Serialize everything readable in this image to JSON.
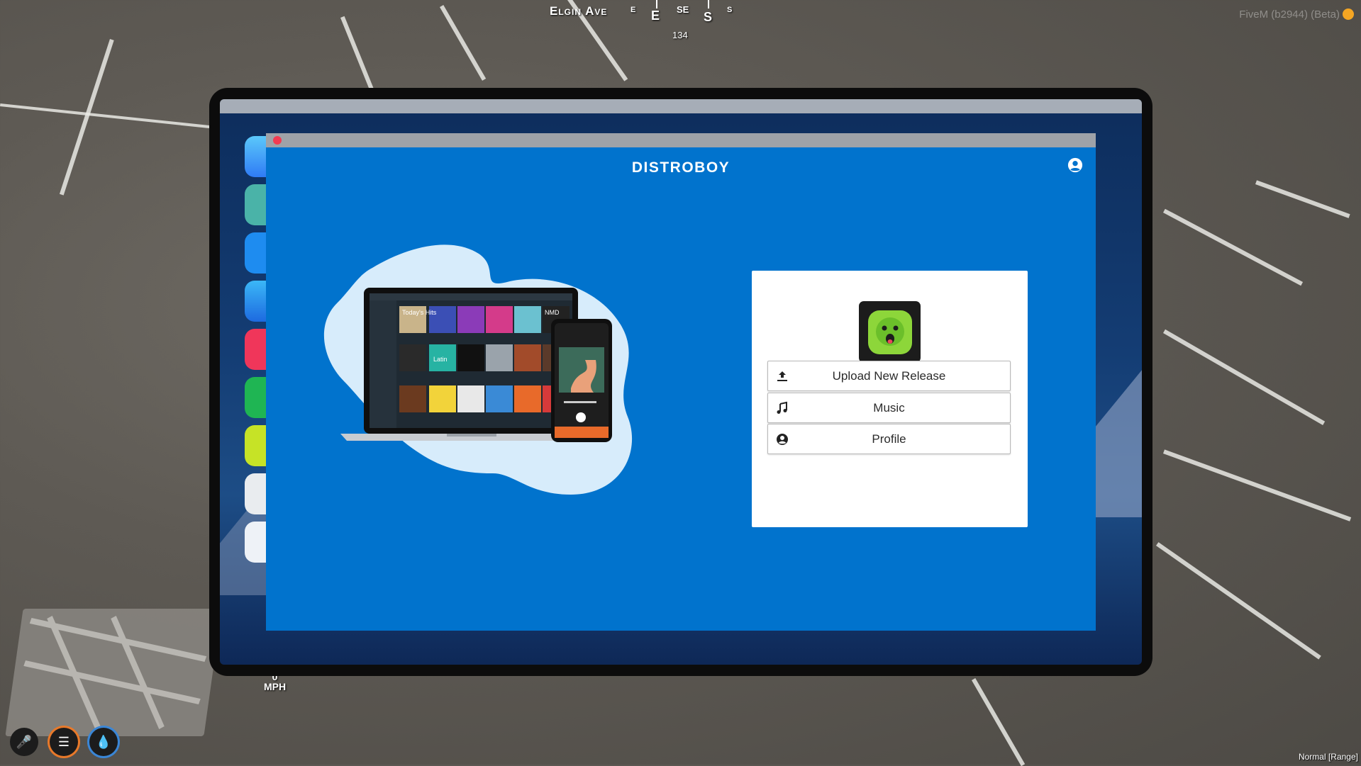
{
  "hud": {
    "street": "Elgin Ave",
    "compass": [
      "E",
      "E",
      "SE",
      "S",
      "S"
    ],
    "heading": "134",
    "fivem_version": "FiveM (b2944) (Beta)",
    "speed_value": "0",
    "speed_unit": "MPH",
    "voice_mode": "Normal [Range]"
  },
  "app": {
    "brand": "DISTROBOY",
    "menu": [
      {
        "label": "Upload New Release",
        "icon": "upload-icon"
      },
      {
        "label": "Music",
        "icon": "music-note-icon"
      },
      {
        "label": "Profile",
        "icon": "user-circle-icon"
      }
    ],
    "album_labels": [
      "Today's Hits",
      "Latin",
      "NMD"
    ],
    "colors": {
      "app_background": "#0173cd",
      "close_dot": "#f23b52",
      "logo_green": "#8dd63a"
    }
  }
}
